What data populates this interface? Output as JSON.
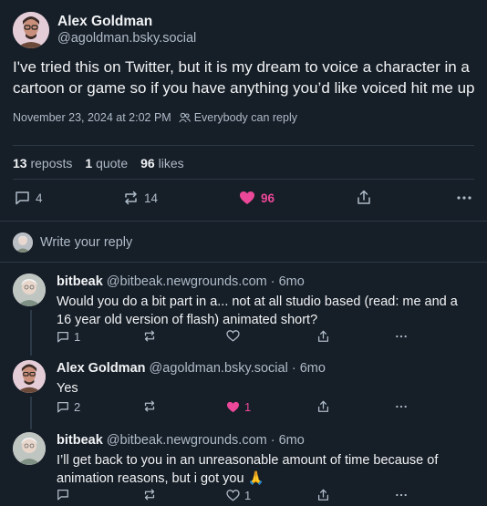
{
  "post": {
    "author_name": "Alex Goldman",
    "author_handle": "@agoldman.bsky.social",
    "text": "I've tried this on Twitter, but it is my dream to voice a character in a cartoon or game so if you have anything you’d like voiced hit me up",
    "timestamp": "November 23, 2024 at 2:02 PM",
    "reply_setting": "Everybody can reply",
    "stats": {
      "reposts_count": "13",
      "reposts_label": "reposts",
      "quotes_count": "1",
      "quotes_label": "quote",
      "likes_count": "96",
      "likes_label": "likes"
    },
    "actions": {
      "reply_count": "4",
      "repost_count": "14",
      "like_count": "96"
    }
  },
  "write_reply_placeholder": "Write your reply",
  "replies": [
    {
      "author_name": "bitbeak",
      "author_handle": "@bitbeak.newgrounds.com",
      "time": "· 6mo",
      "text": "Would you do a bit part in a... not at all studio based (read: me and a 16 year old version of flash) animated short?",
      "reply_count": "1",
      "like_count": ""
    },
    {
      "author_name": "Alex Goldman",
      "author_handle": "@agoldman.bsky.social",
      "time": "· 6mo",
      "text": "Yes",
      "reply_count": "2",
      "like_count": "1"
    },
    {
      "author_name": "bitbeak",
      "author_handle": "@bitbeak.newgrounds.com",
      "time": "· 6mo",
      "text": "I’ll get back to you in an unreasonable amount of time because of animation reasons, but i got you 🙏",
      "reply_count": "",
      "like_count": "1"
    }
  ],
  "colors": {
    "background": "#161e27",
    "text": "#f1f3f5",
    "muted": "#aebbc9",
    "like_pink": "#ec4899",
    "divider": "#2c3946"
  }
}
